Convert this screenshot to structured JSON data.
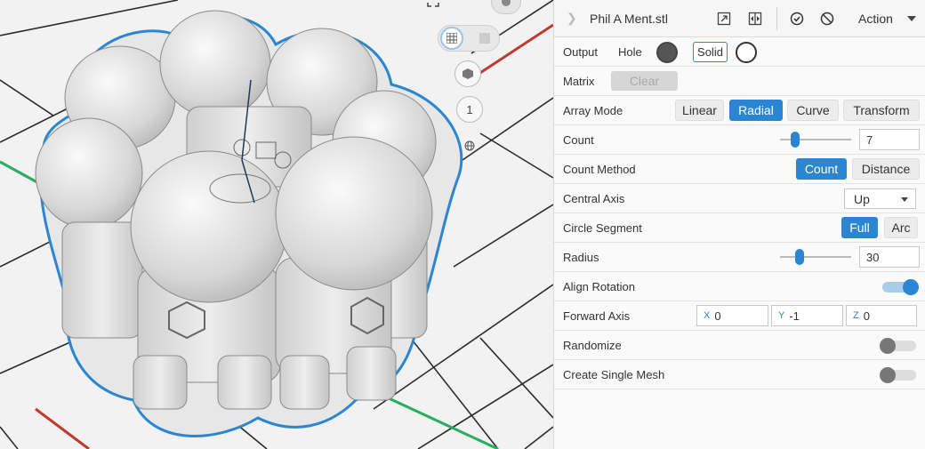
{
  "viewport": {
    "view_number": "1",
    "colors": {
      "selection_outline": "#2a86d3",
      "x_axis": "#c0392b",
      "y_axis": "#27ae60",
      "model": "#d9d9d9"
    }
  },
  "panel": {
    "title": "Phil A Ment.stl",
    "action_label": "Action",
    "output": {
      "label": "Output",
      "hole_label": "Hole",
      "solid_label": "Solid"
    },
    "matrix": {
      "label": "Matrix",
      "clear_label": "Clear"
    },
    "array_mode": {
      "label": "Array Mode",
      "options": [
        "Linear",
        "Radial",
        "Curve",
        "Transform"
      ],
      "selected": "Radial"
    },
    "count": {
      "label": "Count",
      "value": "7"
    },
    "count_method": {
      "label": "Count Method",
      "options": [
        "Count",
        "Distance"
      ],
      "selected": "Count"
    },
    "central_axis": {
      "label": "Central Axis",
      "value": "Up"
    },
    "circle_segment": {
      "label": "Circle Segment",
      "options": [
        "Full",
        "Arc"
      ],
      "selected": "Full"
    },
    "radius": {
      "label": "Radius",
      "value": "30"
    },
    "align_rotation": {
      "label": "Align Rotation",
      "on": true
    },
    "forward_axis": {
      "label": "Forward Axis",
      "x_label": "X",
      "x": "0",
      "y_label": "Y",
      "y": "-1",
      "z_label": "Z",
      "z": "0"
    },
    "randomize": {
      "label": "Randomize",
      "on": false
    },
    "create_single_mesh": {
      "label": "Create Single Mesh",
      "on": false
    },
    "colors": {
      "accent": "#2a86d3",
      "hole_swatch": "#555555"
    }
  }
}
